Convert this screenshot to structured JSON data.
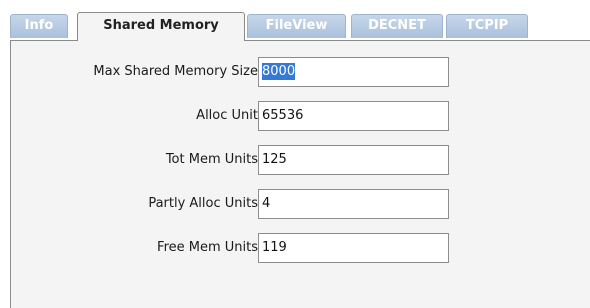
{
  "tabs": [
    {
      "label": "Info",
      "active": false
    },
    {
      "label": "Shared Memory",
      "active": true
    },
    {
      "label": "FileView",
      "active": false
    },
    {
      "label": "DECNET",
      "active": false
    },
    {
      "label": "TCPIP",
      "active": false
    }
  ],
  "form": {
    "max_shared_memory_size": {
      "label": "Max Shared Memory Size",
      "value": "8000",
      "selected": true
    },
    "alloc_unit": {
      "label": "Alloc Unit",
      "value": "65536"
    },
    "tot_mem_units": {
      "label": "Tot Mem Units",
      "value": "125"
    },
    "partly_alloc_units": {
      "label": "Partly Alloc Units",
      "value": "4"
    },
    "free_mem_units": {
      "label": "Free Mem Units",
      "value": "119"
    }
  },
  "colors": {
    "tab_inactive": "#b8cce4",
    "tab_active": "#f4f4f4",
    "panel": "#f4f4f4",
    "selection": "#3478d8"
  }
}
